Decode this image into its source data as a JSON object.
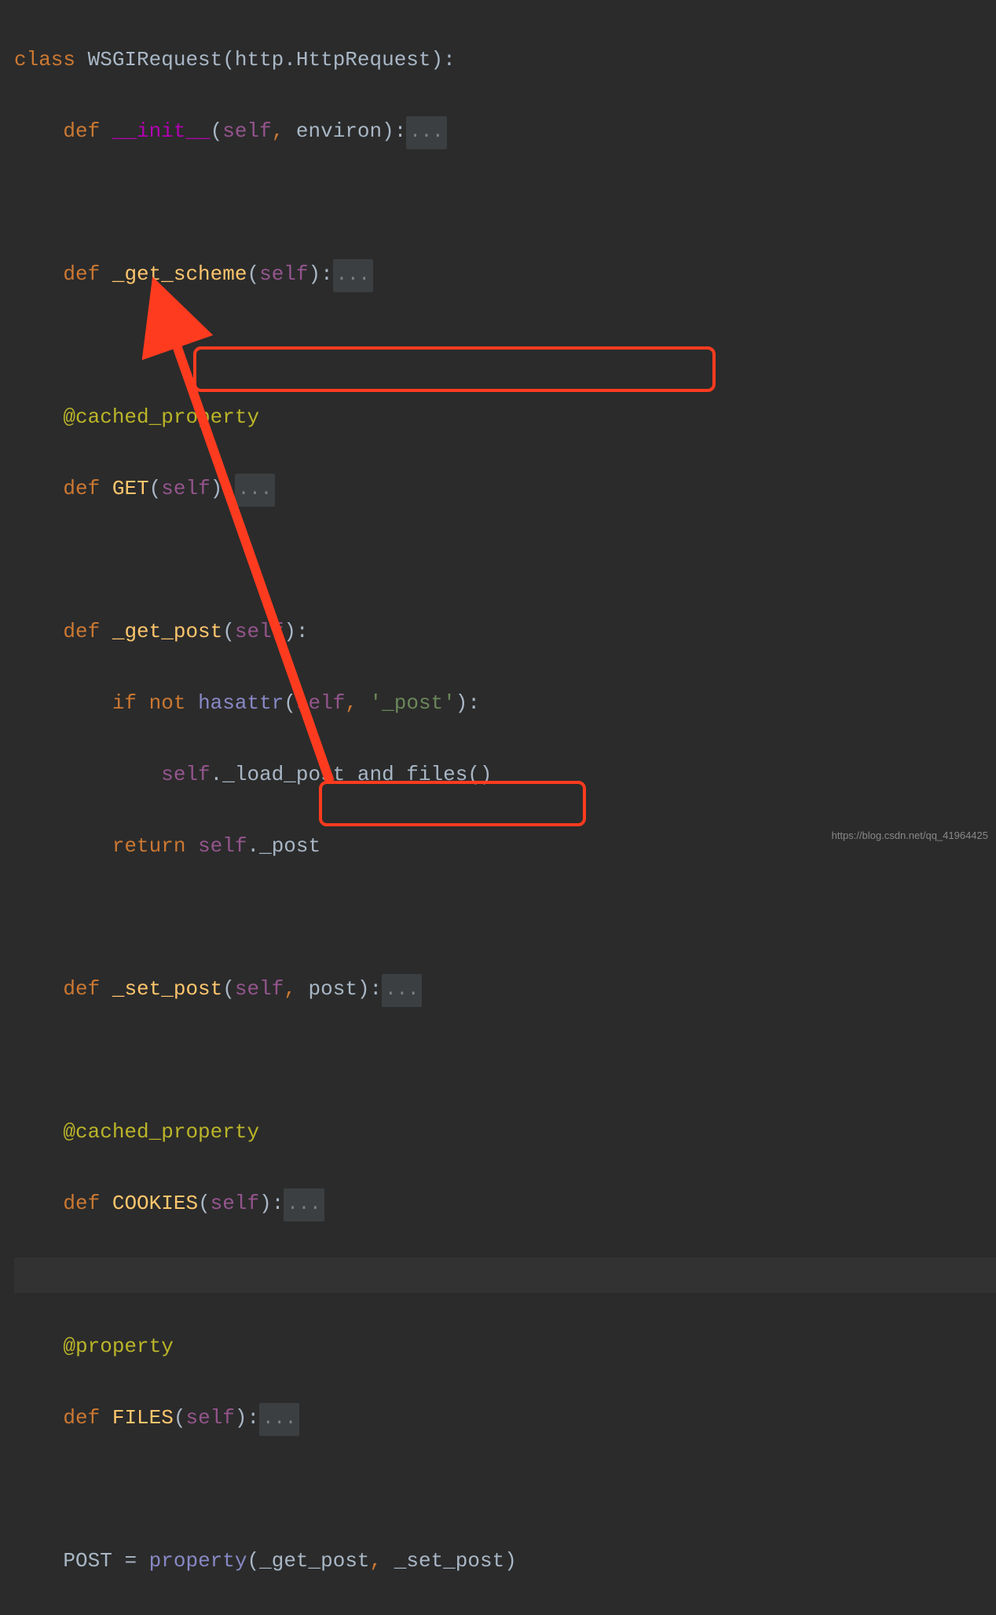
{
  "tokens": {
    "class": "class",
    "def": "def",
    "if": "if",
    "not": "not",
    "return": "return",
    "self": "self",
    "fold": "..."
  },
  "code": {
    "class_name": "WSGIRequest",
    "base_class": "http.HttpRequest",
    "init_name": "__init__",
    "init_param": "environ",
    "get_scheme": "_get_scheme",
    "cached_property": "@cached_property",
    "property": "@property",
    "get_upper": "GET",
    "get_post": "_get_post",
    "hasattr": "hasattr",
    "post_str": "'_post'",
    "load_call": "._load_post_and_files()",
    "post_attr": "._post",
    "set_post": "_set_post",
    "set_post_param": "post",
    "cookies": "COOKIES",
    "files": "FILES",
    "post_assign": "POST",
    "property_call": "property",
    "arg1": "_get_post",
    "arg2": " _set_post"
  },
  "watermark": "https://blog.csdn.net/qq_41964425"
}
